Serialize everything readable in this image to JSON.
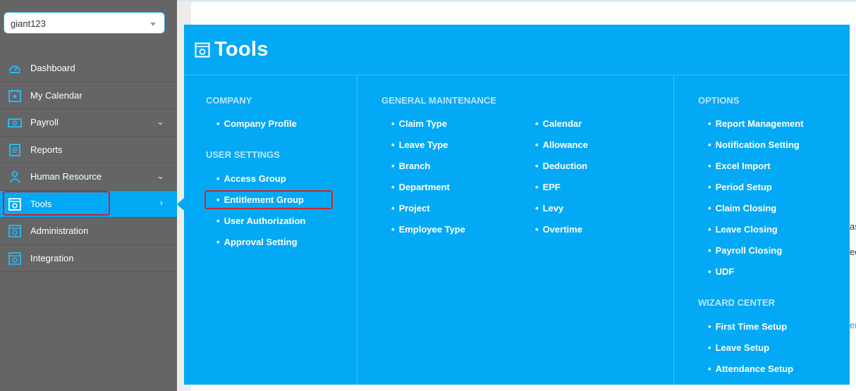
{
  "company_select": {
    "value": "giant123"
  },
  "sidebar": {
    "items": [
      {
        "label": "Dashboard",
        "icon": "gauge-icon"
      },
      {
        "label": "My Calendar",
        "icon": "calendar-icon"
      },
      {
        "label": "Payroll",
        "icon": "money-icon"
      },
      {
        "label": "Reports",
        "icon": "document-icon"
      },
      {
        "label": "Human Resource",
        "icon": "person-icon"
      },
      {
        "label": "Tools",
        "icon": "tools-icon"
      },
      {
        "label": "Administration",
        "icon": "gear-window-icon"
      },
      {
        "label": "Integration",
        "icon": "integration-icon"
      }
    ]
  },
  "menu": {
    "title": "Tools",
    "company": {
      "heading": "COMPANY",
      "items": [
        "Company Profile"
      ]
    },
    "user_settings": {
      "heading": "USER SETTINGS",
      "items": [
        "Access Group",
        "Entitlement Group",
        "User Authorization",
        "Approval Setting"
      ]
    },
    "general": {
      "heading": "GENERAL MAINTENANCE",
      "col1": [
        "Claim Type",
        "Leave Type",
        "Branch",
        "Department",
        "Project",
        "Employee Type"
      ],
      "col2": [
        "Calendar",
        "Allowance",
        "Deduction",
        "EPF",
        "Levy",
        "Overtime"
      ]
    },
    "options": {
      "heading": "OPTIONS",
      "items": [
        "Report Management",
        "Notification Setting",
        "Excel Import",
        "Period Setup",
        "Claim Closing",
        "Leave Closing",
        "Payroll Closing",
        "UDF"
      ]
    },
    "wizard": {
      "heading": "WIZARD CENTER",
      "items": [
        "First Time Setup",
        "Leave Setup",
        "Attendance Setup"
      ]
    }
  },
  "background_fragments": [
    "as",
    "ec",
    "er"
  ],
  "colors": {
    "accent": "#03a9f4",
    "sidebar": "#656565",
    "highlight": "#c8262c"
  }
}
